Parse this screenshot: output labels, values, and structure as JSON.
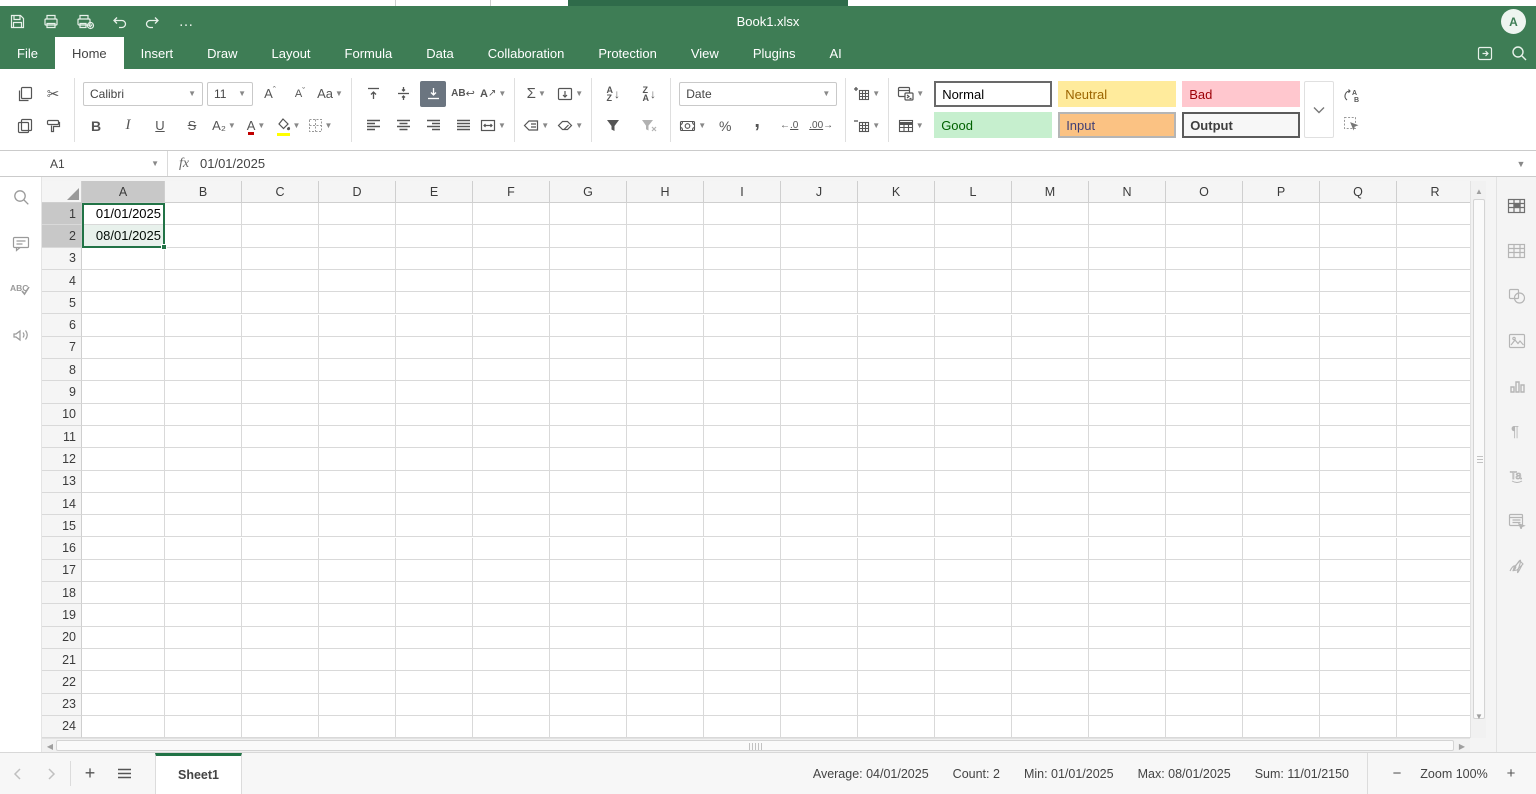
{
  "titlebar": {
    "title": "Book1.xlsx",
    "avatar": "A",
    "quick_access": [
      "save",
      "print",
      "quick-print",
      "undo",
      "redo",
      "more"
    ]
  },
  "menu": {
    "tabs": [
      {
        "label": "File",
        "active": false
      },
      {
        "label": "Home",
        "active": true
      },
      {
        "label": "Insert",
        "active": false
      },
      {
        "label": "Draw",
        "active": false
      },
      {
        "label": "Layout",
        "active": false
      },
      {
        "label": "Formula",
        "active": false
      },
      {
        "label": "Data",
        "active": false
      },
      {
        "label": "Collaboration",
        "active": false
      },
      {
        "label": "Protection",
        "active": false
      },
      {
        "label": "View",
        "active": false
      },
      {
        "label": "Plugins",
        "active": false
      },
      {
        "label": "AI",
        "active": false
      }
    ],
    "right_icons": [
      "open-file-location",
      "search"
    ]
  },
  "toolbar": {
    "font_name": "Calibri",
    "font_size": "11",
    "number_format": "Date",
    "bold_label": "B",
    "italic_label": "I",
    "underline_label": "U",
    "strike_label": "S",
    "subscript_label": "A₂",
    "change_case_label": "Aa",
    "sum_label": "Σ",
    "percent_label": "%",
    "comma_label": ",",
    "accent_font_color": "#c00000",
    "accent_fill_color": "#ffff00",
    "cell_styles": [
      {
        "label": "Normal",
        "bg": "#ffffff",
        "fg": "#000000",
        "border": "#696969"
      },
      {
        "label": "Neutral",
        "bg": "#ffeb9c",
        "fg": "#9c6500",
        "border": "transparent"
      },
      {
        "label": "Bad",
        "bg": "#ffc7ce",
        "fg": "#9c0006",
        "border": "transparent"
      },
      {
        "label": "Good",
        "bg": "#c6efce",
        "fg": "#006100",
        "border": "transparent"
      },
      {
        "label": "Input",
        "bg": "#fbc283",
        "fg": "#3f3f76",
        "border": "#b5b5b5"
      },
      {
        "label": "Output",
        "bg": "#f7f7f7",
        "fg": "#3f3f3f",
        "border": "#5b5b5b",
        "bold": true
      }
    ]
  },
  "formula_bar": {
    "cell_ref": "A1",
    "fx_label": "fx",
    "value": "01/01/2025"
  },
  "grid": {
    "columns": [
      "A",
      "B",
      "C",
      "D",
      "E",
      "F",
      "G",
      "H",
      "I",
      "J",
      "K",
      "L",
      "M",
      "N",
      "O",
      "P",
      "Q",
      "R"
    ],
    "visible_rows": 24,
    "cells": [
      {
        "ref": "A1",
        "value": "01/01/2025"
      },
      {
        "ref": "A2",
        "value": "08/01/2025"
      }
    ],
    "selected_range": "A1:A2",
    "active_cell": "A1",
    "selection_color": "#217346"
  },
  "left_sidebar": {
    "icons": [
      "search",
      "comments",
      "spellcheck",
      "feedback"
    ]
  },
  "right_sidebar": {
    "icons": [
      "cell-settings",
      "table-settings",
      "shape-settings",
      "image-settings",
      "chart-settings",
      "paragraph-settings",
      "textart-settings",
      "pivot-settings",
      "signature-settings"
    ]
  },
  "status_bar": {
    "sheet_tab": "Sheet1",
    "stats": [
      {
        "label": "Average:",
        "value": "04/01/2025"
      },
      {
        "label": "Count:",
        "value": "2"
      },
      {
        "label": "Min:",
        "value": "01/01/2025"
      },
      {
        "label": "Max:",
        "value": "08/01/2025"
      },
      {
        "label": "Sum:",
        "value": "11/01/2150"
      }
    ],
    "zoom_label": "Zoom 100%"
  }
}
